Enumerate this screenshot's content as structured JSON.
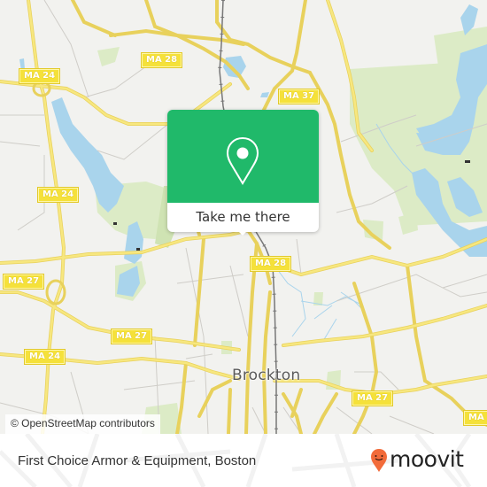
{
  "map": {
    "city_label": "Brockton",
    "attribution": "© OpenStreetMap contributors",
    "route_shields": [
      {
        "id": "ma24-nw",
        "label": "MA 24"
      },
      {
        "id": "ma28-n",
        "label": "MA 28"
      },
      {
        "id": "ma37",
        "label": "MA 37"
      },
      {
        "id": "ma24-w",
        "label": "MA 24"
      },
      {
        "id": "ma27-w",
        "label": "MA 27"
      },
      {
        "id": "ma28-c",
        "label": "MA 28"
      },
      {
        "id": "ma27-c",
        "label": "MA 27"
      },
      {
        "id": "ma24-sw",
        "label": "MA 24"
      },
      {
        "id": "ma27-e",
        "label": "MA 27"
      },
      {
        "id": "ma-se",
        "label": "MA"
      }
    ]
  },
  "popup": {
    "action_label": "Take me there",
    "icon": "map-pin-icon",
    "accent_color": "#20b96a"
  },
  "footer": {
    "place_name": "First Choice Armor & Equipment, Boston",
    "brand": "moovit",
    "brand_color": "#f26b3a"
  }
}
